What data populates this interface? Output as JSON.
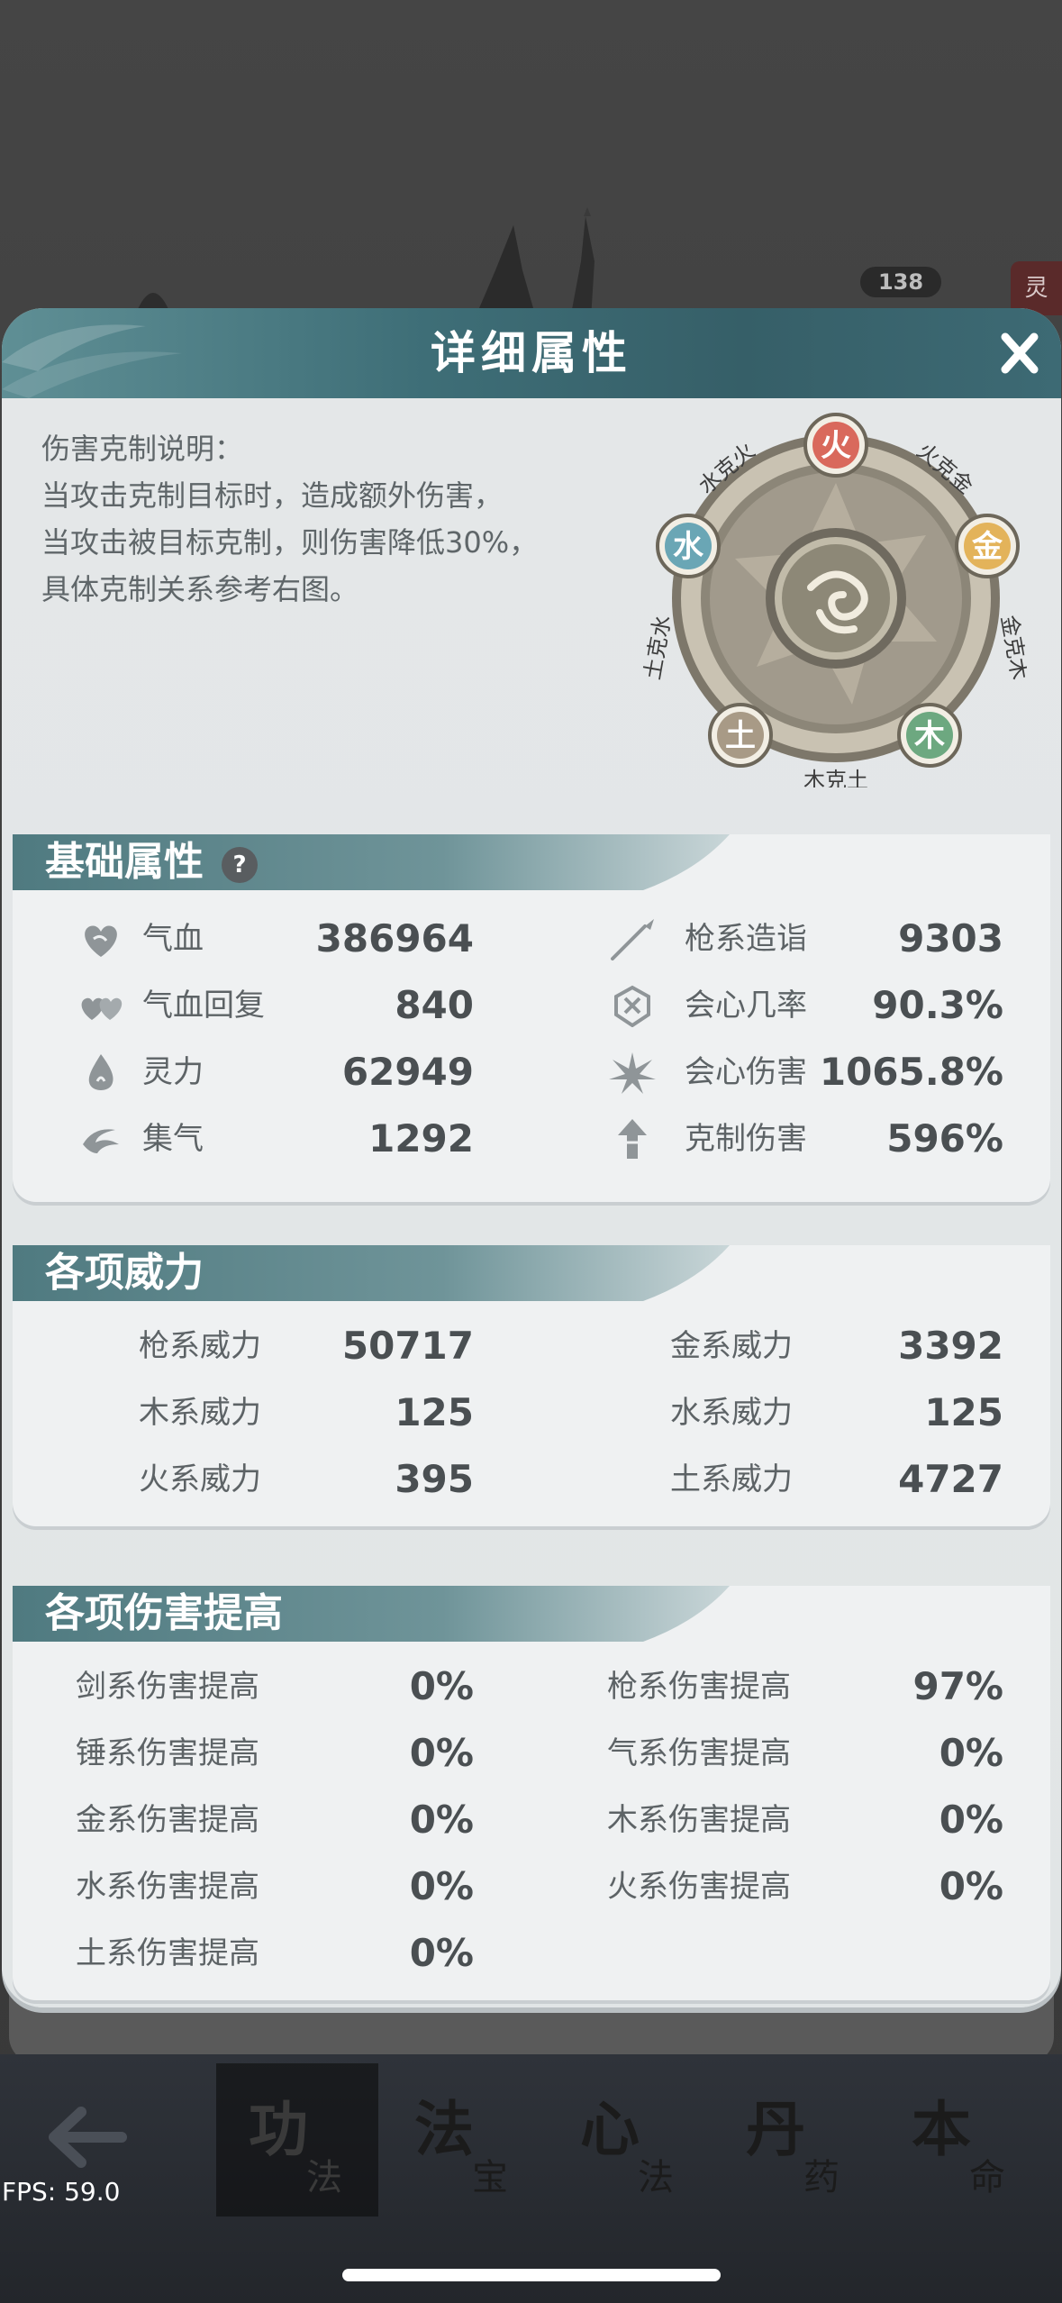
{
  "background": {
    "level_badge": "138",
    "side_tag": "灵"
  },
  "modal": {
    "title": "详细属性",
    "close_label": "X",
    "description": [
      "伤害克制说明：",
      "当攻击克制目标时，造成额外伤害，",
      "当攻击被目标克制，则伤害降低30%，",
      "具体克制关系参考右图。"
    ],
    "wheel": {
      "elements": {
        "fire": "火",
        "metal": "金",
        "wood": "木",
        "earth": "土",
        "water": "水"
      },
      "relations": {
        "water_fire": "水克火",
        "fire_metal": "火克金",
        "metal_wood": "金克木",
        "wood_earth": "木克土",
        "earth_water": "土克水"
      },
      "colors": {
        "fire": "#d9695c",
        "metal": "#e3b35a",
        "wood": "#6da880",
        "earth": "#a89a86",
        "water": "#6aa6b5"
      }
    },
    "basic": {
      "title": "基础属性",
      "help": "?",
      "left": [
        {
          "icon": "heart-icon",
          "label": "气血",
          "value": "386964"
        },
        {
          "icon": "double-heart-icon",
          "label": "气血回复",
          "value": "840"
        },
        {
          "icon": "flame-drop-icon",
          "label": "灵力",
          "value": "62949"
        },
        {
          "icon": "swirl-icon",
          "label": "集气",
          "value": "1292"
        }
      ],
      "right": [
        {
          "icon": "spear-icon",
          "label": "枪系造诣",
          "value": "9303"
        },
        {
          "icon": "shield-rune-icon",
          "label": "会心几率",
          "value": "90.3%"
        },
        {
          "icon": "burst-star-icon",
          "label": "会心伤害",
          "value": "1065.8%"
        },
        {
          "icon": "arrow-up-icon",
          "label": "克制伤害",
          "value": "596%"
        }
      ]
    },
    "power": {
      "title": "各项威力",
      "left": [
        {
          "label": "枪系威力",
          "value": "50717"
        },
        {
          "label": "木系威力",
          "value": "125"
        },
        {
          "label": "火系威力",
          "value": "395"
        }
      ],
      "right": [
        {
          "label": "金系威力",
          "value": "3392"
        },
        {
          "label": "水系威力",
          "value": "125"
        },
        {
          "label": "土系威力",
          "value": "4727"
        }
      ]
    },
    "damage": {
      "title": "各项伤害提高",
      "left": [
        {
          "label": "剑系伤害提高",
          "value": "0%"
        },
        {
          "label": "锤系伤害提高",
          "value": "0%"
        },
        {
          "label": "金系伤害提高",
          "value": "0%"
        },
        {
          "label": "水系伤害提高",
          "value": "0%"
        },
        {
          "label": "土系伤害提高",
          "value": "0%"
        }
      ],
      "right": [
        {
          "label": "枪系伤害提高",
          "value": "97%"
        },
        {
          "label": "气系伤害提高",
          "value": "0%"
        },
        {
          "label": "木系伤害提高",
          "value": "0%"
        },
        {
          "label": "火系伤害提高",
          "value": "0%"
        }
      ]
    }
  },
  "nav": {
    "tabs": [
      {
        "big": "功",
        "small": "法"
      },
      {
        "big": "法",
        "small": "宝"
      },
      {
        "big": "心",
        "small": "法"
      },
      {
        "big": "丹",
        "small": "药"
      },
      {
        "big": "本",
        "small": "命"
      }
    ]
  },
  "fps": "FPS: 59.0"
}
